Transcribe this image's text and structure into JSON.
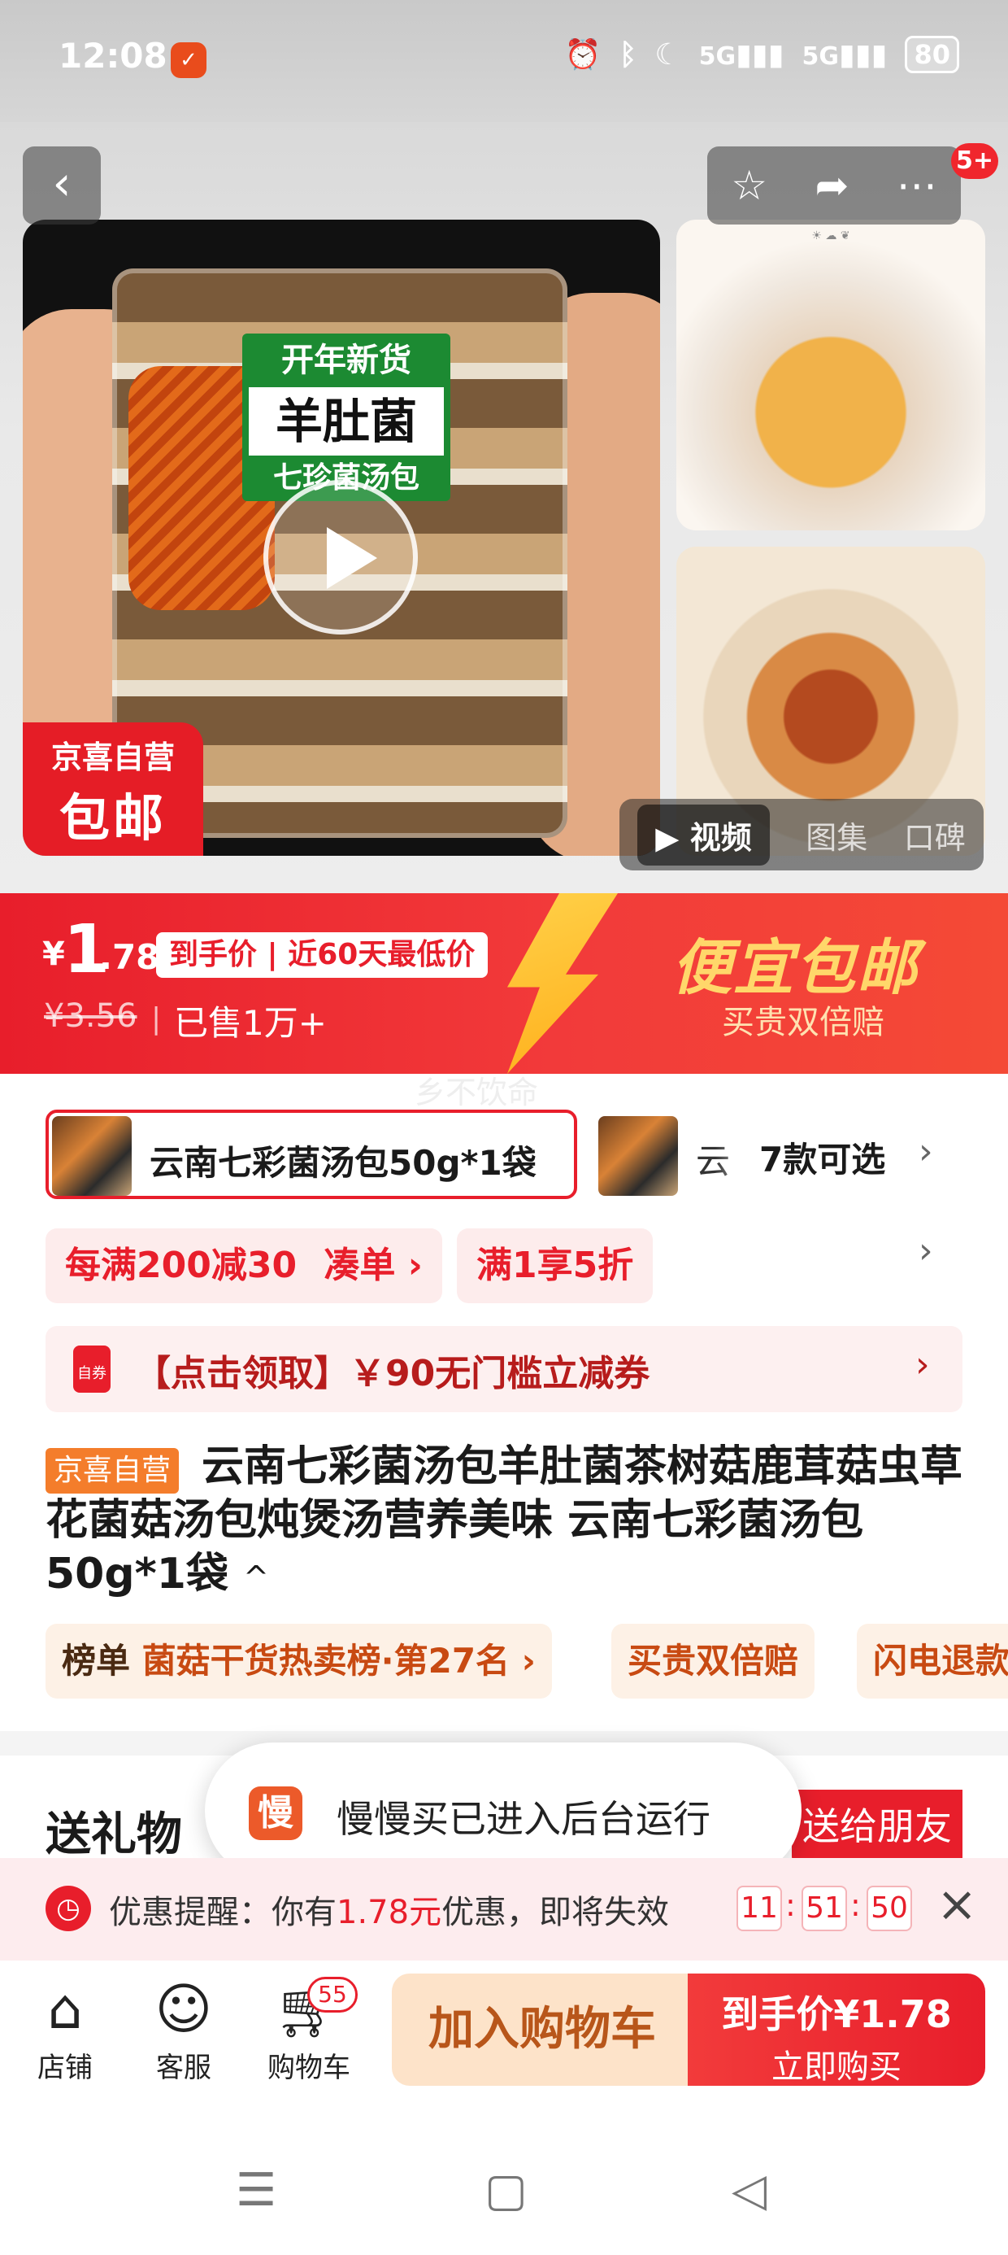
{
  "status_bar": {
    "time": "12:08",
    "battery": "80",
    "signal1": "5G",
    "signal2": "5G"
  },
  "gallery": {
    "main_tags": [
      "开年新货",
      "羊肚菌",
      "七珍菌汤包"
    ],
    "badge_line1": "京喜自营",
    "badge_line2": "包邮",
    "cart_count_badge": "5+",
    "media_tabs": [
      "视频",
      "图集",
      "口碑"
    ]
  },
  "price": {
    "currency": "¥",
    "integer": "1",
    "decimal": ".78",
    "tag": "到手价 | 近60天最低价",
    "original": "¥3.56",
    "separator": "|",
    "sold": "已售1万+",
    "slogan": "便宜包邮",
    "slogan_sub": "买贵双倍赔",
    "ghost_text": "乡不饮命"
  },
  "sku": {
    "selected": "云南七彩菌汤包50g*1袋",
    "second_partial": "云",
    "more": "7款可选"
  },
  "promos": {
    "chip1": "每满200减30",
    "chip1_link": "凑单",
    "chip2": "满1享5折",
    "coupon_icon": "自券",
    "coupon": "【点击领取】￥90无门槛立减券"
  },
  "title": {
    "badge": "京喜自营",
    "text": "云南七彩菌汤包羊肚菌茶树菇鹿茸菇虫草花菌菇汤包炖煲汤营养美味 云南七彩菌汤包50g*1袋",
    "caret": "^"
  },
  "rank_chips": {
    "r1_key": "榜单",
    "r1_value": "菌菇干货热卖榜·第27名",
    "r2": "买贵双倍赔",
    "r3": "闪电退款"
  },
  "gift": {
    "title": "送礼物",
    "button": "送给朋友"
  },
  "toast": {
    "icon": "慢",
    "text": "慢慢买已进入后台运行"
  },
  "reminder": {
    "prefix": "优惠提醒：你有",
    "amount": "1.78元",
    "suffix": "优惠，即将失效",
    "hh": "11",
    "mm": "51",
    "ss": "50"
  },
  "bottom_bar": {
    "store": "店铺",
    "service": "客服",
    "cart": "购物车",
    "cart_count": "55",
    "add_to_cart": "加入购物车",
    "buy_line1": "到手价¥1.78",
    "buy_line2": "立即购买"
  },
  "colors": {
    "brand_red": "#e81e2b",
    "coupon_gold": "#ffd76a",
    "cart_bg": "#fde3c9",
    "toast_icon": "#ec5a2a"
  }
}
